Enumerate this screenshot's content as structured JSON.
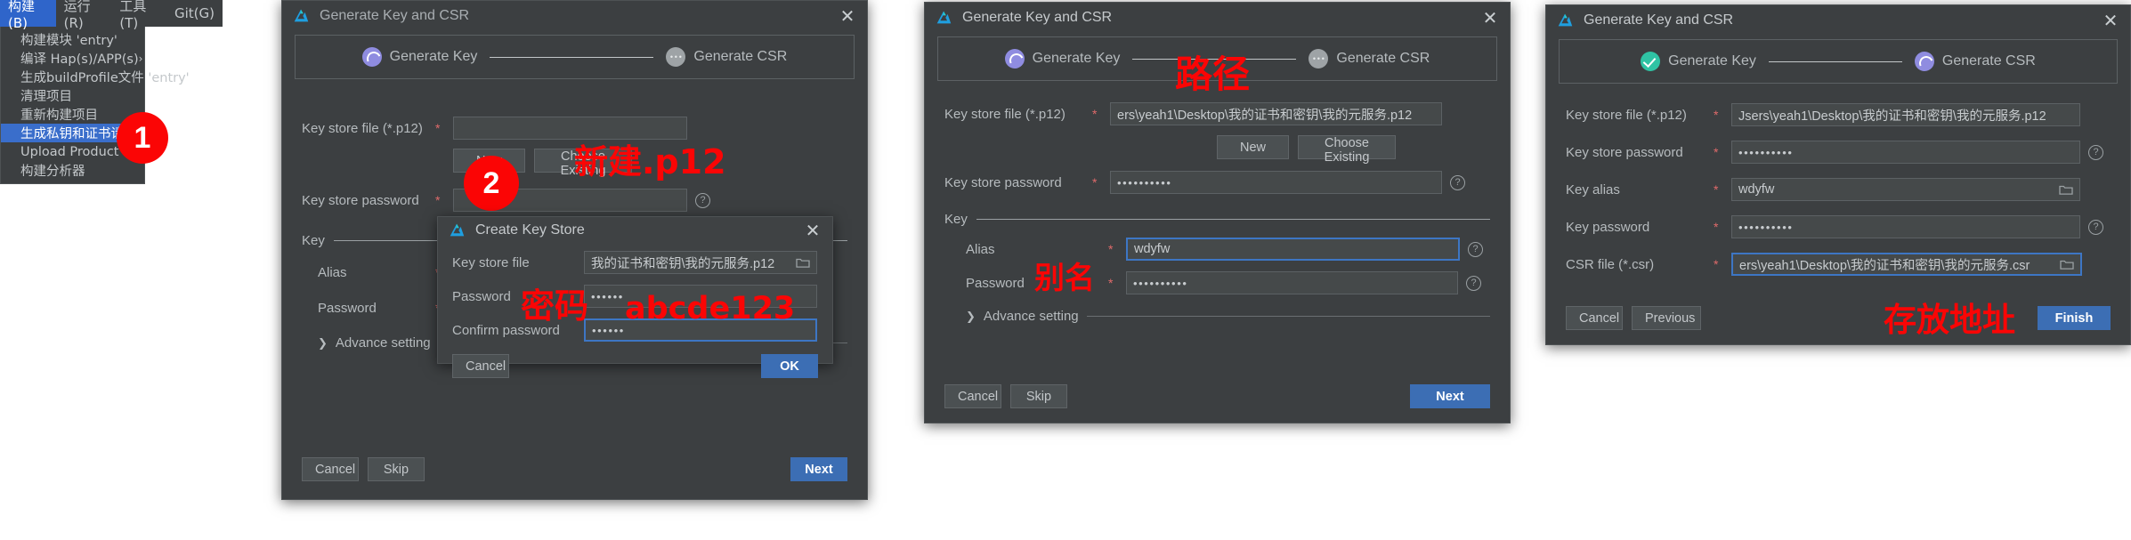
{
  "ide_menu": {
    "menubar": [
      {
        "label": "构建(B)",
        "active": true
      },
      {
        "label": "运行(R)",
        "active": false
      },
      {
        "label": "工具(T)",
        "active": false
      },
      {
        "label": "Git(G)",
        "active": false
      }
    ],
    "items": [
      {
        "label": "构建模块 'entry'",
        "selected": false,
        "submenu": ""
      },
      {
        "label": "编译 Hap(s)/APP(s)",
        "selected": false,
        "submenu": "›"
      },
      {
        "label": "生成buildProfile文件 'entry'",
        "selected": false,
        "submenu": ""
      },
      {
        "label": "清理项目",
        "selected": false,
        "submenu": ""
      },
      {
        "label": "重新构建项目",
        "selected": false,
        "submenu": ""
      },
      {
        "label": "生成私钥和证书请求文件",
        "selected": true,
        "submenu": ""
      },
      {
        "label": "Upload Product",
        "selected": false,
        "submenu": ""
      },
      {
        "label": "构建分析器",
        "selected": false,
        "submenu": ""
      }
    ]
  },
  "annotations": {
    "badge1": "1",
    "badge2": "2",
    "new_p12": "新建.p12",
    "password_cn": "密码",
    "password_value": "abcde123",
    "path_cn": "路径",
    "alias_cn": "别名",
    "store_addr_cn": "存放地址"
  },
  "dialog1": {
    "title": "Generate Key and CSR",
    "steps": [
      {
        "label": "Generate Key",
        "state": "active"
      },
      {
        "label": "Generate CSR",
        "state": "idle"
      }
    ],
    "key_store_file": {
      "label": "Key store file (*.p12)",
      "required": "*",
      "value": "",
      "placeholder": ""
    },
    "buttons_file": {
      "new": "New",
      "choose": "Choose Existing"
    },
    "key_store_password": {
      "label": "Key store password",
      "required": "*",
      "value": ""
    },
    "group_key": "Key",
    "alias": {
      "label": "Alias",
      "required": "*",
      "value": ""
    },
    "password": {
      "label": "Password",
      "required": "*",
      "value": ""
    },
    "advance": "Advance setting",
    "footer": {
      "cancel": "Cancel",
      "skip": "Skip",
      "next": "Next"
    }
  },
  "create_key_store": {
    "title": "Create Key Store",
    "key_store_file": {
      "label": "Key store file",
      "value": "我的证书和密钥\\我的元服务.p12"
    },
    "password": {
      "label": "Password",
      "value": "••••••"
    },
    "confirm_password": {
      "label": "Confirm password",
      "value": "••••••"
    },
    "footer": {
      "cancel": "Cancel",
      "ok": "OK"
    }
  },
  "dialog2": {
    "title": "Generate Key and CSR",
    "steps": [
      {
        "label": "Generate Key",
        "state": "active"
      },
      {
        "label": "Generate CSR",
        "state": "idle"
      }
    ],
    "key_store_file": {
      "label": "Key store file (*.p12)",
      "required": "*",
      "value": "ers\\yeah1\\Desktop\\我的证书和密钥\\我的元服务.p12"
    },
    "buttons_file": {
      "new": "New",
      "choose": "Choose Existing"
    },
    "key_store_password": {
      "label": "Key store password",
      "required": "*",
      "value": "••••••••••"
    },
    "group_key": "Key",
    "alias": {
      "label": "Alias",
      "required": "*",
      "value": "wdyfw"
    },
    "password": {
      "label": "Password",
      "required": "*",
      "value": "••••••••••"
    },
    "advance": "Advance setting",
    "footer": {
      "cancel": "Cancel",
      "skip": "Skip",
      "next": "Next"
    }
  },
  "dialog3": {
    "title": "Generate Key and CSR",
    "steps": [
      {
        "label": "Generate Key",
        "state": "done"
      },
      {
        "label": "Generate CSR",
        "state": "active"
      }
    ],
    "key_store_file": {
      "label": "Key store file (*.p12)",
      "required": "*",
      "value": "Jsers\\yeah1\\Desktop\\我的证书和密钥\\我的元服务.p12"
    },
    "key_store_password": {
      "label": "Key store password",
      "required": "*",
      "value": "••••••••••"
    },
    "key_alias": {
      "label": "Key alias",
      "required": "*",
      "value": "wdyfw"
    },
    "key_password": {
      "label": "Key password",
      "required": "*",
      "value": "••••••••••"
    },
    "csr_file": {
      "label": "CSR file (*.csr)",
      "required": "*",
      "value": "ers\\yeah1\\Desktop\\我的证书和密钥\\我的元服务.csr"
    },
    "footer": {
      "cancel": "Cancel",
      "previous": "Previous",
      "finish": "Finish"
    }
  },
  "colors": {
    "dialog_bg": "#3c3f41",
    "field_bg": "#45494a",
    "accent_blue": "#3c6eb4",
    "focus_blue": "#3d76c4",
    "marker_red": "#fb0505",
    "step_active": "#8f8ce0",
    "step_done": "#2fc3a4",
    "menu_select": "#3a6ecb"
  }
}
